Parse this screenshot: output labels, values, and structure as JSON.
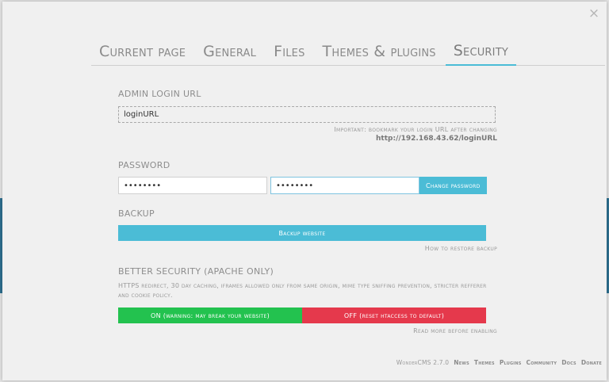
{
  "modal": {
    "close_glyph": "×"
  },
  "tabs": [
    {
      "label": "Current page"
    },
    {
      "label": "General"
    },
    {
      "label": "Files"
    },
    {
      "label": "Themes & plugins"
    },
    {
      "label": "Security"
    }
  ],
  "security": {
    "admin_login": {
      "title": "ADMIN LOGIN URL",
      "value": "loginURL",
      "hint": "Important: bookmark your login URL after changing",
      "url": "http://192.168.43.62/loginURL"
    },
    "password": {
      "title": "PASSWORD",
      "old_value": "••••••••",
      "new_value": "••••••••",
      "button": "Change password"
    },
    "backup": {
      "title": "BACKUP",
      "button": "Backup website",
      "link": "How to restore backup"
    },
    "better_security": {
      "title": "BETTER SECURITY (APACHE ONLY)",
      "description": "HTTPS redirect, 30 day caching, iframes allowed only from same origin, mime type sniffing prevention, stricter refferer and cookie policy.",
      "on_button": "ON (warning: may break your website)",
      "off_button": "OFF (reset htaccess to default)",
      "link": "Read more before enabling"
    }
  },
  "footer": {
    "version": "WonderCMS 2.7.0",
    "links": [
      "News",
      "Themes",
      "Plugins",
      "Community",
      "Docs",
      "Donate"
    ]
  },
  "colors": {
    "accent": "#4bbcd6",
    "on": "#23c24f",
    "off": "#e5394c"
  }
}
